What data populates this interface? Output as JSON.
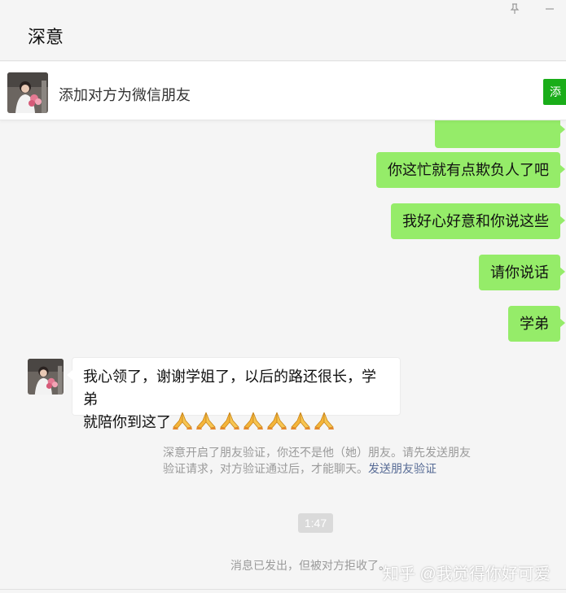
{
  "window": {
    "title": "深意",
    "pin_icon": "pin-icon",
    "minimize_icon": "minimize-icon"
  },
  "add_friend_bar": {
    "text": "添加对方为微信朋友",
    "button_label": "添"
  },
  "messages": {
    "sent": [
      "你这忙就有点欺负人了吧",
      "我好心好意和你说这些",
      "请你说话",
      "学弟"
    ],
    "received": {
      "line1": "我心领了，谢谢学姐了，以后的路还很长，学弟",
      "line2": "就陪你到这了",
      "emoji": "pray-hands-icon",
      "emoji_count": 7
    }
  },
  "system": {
    "notice": "深意开启了朋友验证，你还不是他（她）朋友。请先发送朋友验证请求，对方验证通过后，才能聊天。",
    "link": "发送朋友验证",
    "time": "1:47",
    "status": "消息已发出，但被对方拒收了。"
  },
  "watermark": "知乎 @我觉得你好可爱",
  "colors": {
    "sent_bubble": "#95ec69",
    "add_button": "#1aad19",
    "link": "#576b95"
  }
}
